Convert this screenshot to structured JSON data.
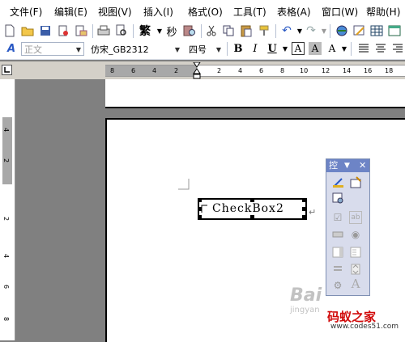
{
  "menubar": {
    "items": [
      "文件(F)",
      "编辑(E)",
      "视图(V)",
      "插入(I)",
      "格式(O)",
      "工具(T)",
      "表格(A)",
      "窗口(W)",
      "帮助(H)"
    ]
  },
  "format_toolbar": {
    "style_value": "正文",
    "font_value": "仿宋_GB2312",
    "size_value": "四号",
    "bold": "B",
    "italic": "I",
    "underline": "U",
    "char_border": "A",
    "char_shading": "A"
  },
  "standard_toolbar": {
    "traditional_label": "繁",
    "swap_label": "秒"
  },
  "ruler": {
    "labels": [
      "8",
      "6",
      "4",
      "2",
      "2",
      "4",
      "6",
      "8",
      "10",
      "12",
      "14",
      "16",
      "18"
    ],
    "vertical_labels": [
      "4",
      "2",
      "2",
      "4",
      "6",
      "8"
    ]
  },
  "document": {
    "checkbox_label": "CheckBox2"
  },
  "control_toolbox": {
    "title": "控"
  },
  "watermark": {
    "site_name": "码蚁之家",
    "site_url": "www.codes51.com",
    "baidu": "Bai",
    "jingyan": "jingyan"
  },
  "colors": {
    "accent": "#6d84c6",
    "watermark_red": "#d10a0a"
  }
}
